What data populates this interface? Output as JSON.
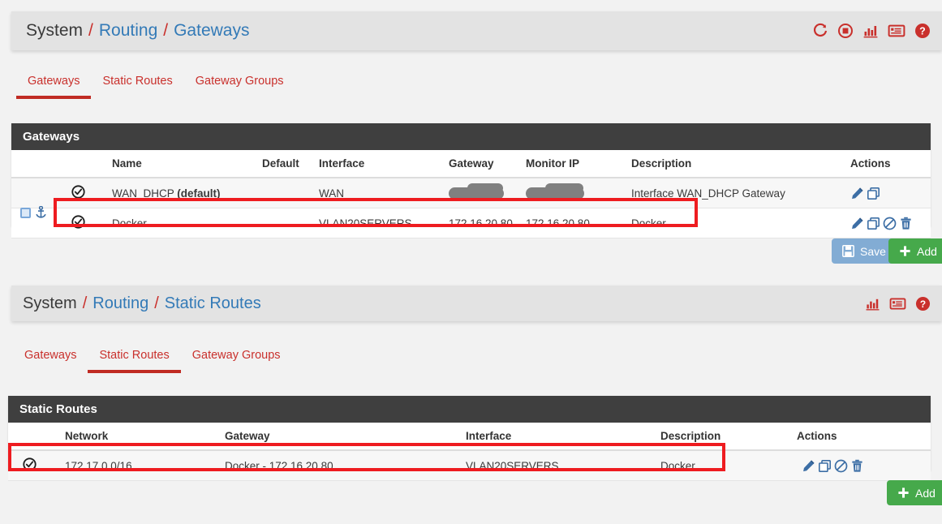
{
  "sections": [
    {
      "header": {
        "breadcrumb": [
          "System",
          "Routing",
          "Gateways"
        ],
        "separator": "/",
        "icons": [
          "refresh-icon",
          "stop-icon",
          "chart-icon",
          "log-icon",
          "help-icon"
        ]
      },
      "tabs": [
        {
          "label": "Gateways",
          "active": true
        },
        {
          "label": "Static Routes",
          "active": false
        },
        {
          "label": "Gateway Groups",
          "active": false
        }
      ],
      "panel_title": "Gateways",
      "columns": [
        "",
        "",
        "Name",
        "Default",
        "Interface",
        "Gateway",
        "Monitor IP",
        "Description",
        "Actions"
      ],
      "rows": [
        {
          "status": "check-circle-icon",
          "name": "WAN_DHCP",
          "name_suffix": "(default)",
          "default": "",
          "interface": "WAN",
          "gateway": "[redacted]",
          "gateway_redacted": true,
          "monitor_ip": "[redacted]",
          "monitor_redacted": true,
          "description": "Interface WAN_DHCP Gateway",
          "actions": [
            "edit-icon",
            "copy-icon"
          ],
          "gutter": false,
          "highlighted": false
        },
        {
          "status": "check-circle-icon",
          "name": "Docker",
          "name_suffix": "",
          "default": "",
          "interface": "VLAN20SERVERS",
          "gateway": "172.16.20.80",
          "gateway_redacted": false,
          "monitor_ip": "172.16.20.80",
          "monitor_redacted": false,
          "description": "Docker",
          "actions": [
            "edit-icon",
            "copy-icon",
            "disable-icon",
            "delete-icon"
          ],
          "gutter": true,
          "highlighted": true
        }
      ],
      "buttons": [
        {
          "label": "Save",
          "style": "save",
          "icon": "floppy-icon"
        },
        {
          "label": "Add",
          "style": "add",
          "icon": "plus-icon"
        }
      ]
    },
    {
      "header": {
        "breadcrumb": [
          "System",
          "Routing",
          "Static Routes"
        ],
        "separator": "/",
        "icons": [
          "chart-icon",
          "log-icon",
          "help-icon"
        ]
      },
      "tabs": [
        {
          "label": "Gateways",
          "active": false
        },
        {
          "label": "Static Routes",
          "active": true
        },
        {
          "label": "Gateway Groups",
          "active": false
        }
      ],
      "panel_title": "Static Routes",
      "columns": [
        "",
        "Network",
        "Gateway",
        "Interface",
        "Description",
        "Actions"
      ],
      "rows": [
        {
          "status": "check-circle-icon",
          "network": "172.17.0.0/16",
          "gateway": "Docker - 172.16.20.80",
          "interface": "VLAN20SERVERS",
          "description": "Docker",
          "actions": [
            "edit-icon",
            "copy-icon",
            "disable-icon",
            "delete-icon"
          ],
          "highlighted": true
        }
      ],
      "buttons": [
        {
          "label": "Add",
          "style": "add",
          "icon": "plus-icon"
        }
      ]
    }
  ],
  "colors": {
    "accent_red": "#c9302c",
    "link_blue": "#337ab7",
    "panel_dark": "#3f3f3f",
    "add_green": "#46a94b",
    "save_blue": "#82acd4",
    "action_blue": "#3c6ea5",
    "annotation_red": "#ee1c20",
    "redaction_grey": "#808080",
    "page_bg": "#f2f2f2",
    "header_bg": "#e3e3e3"
  }
}
